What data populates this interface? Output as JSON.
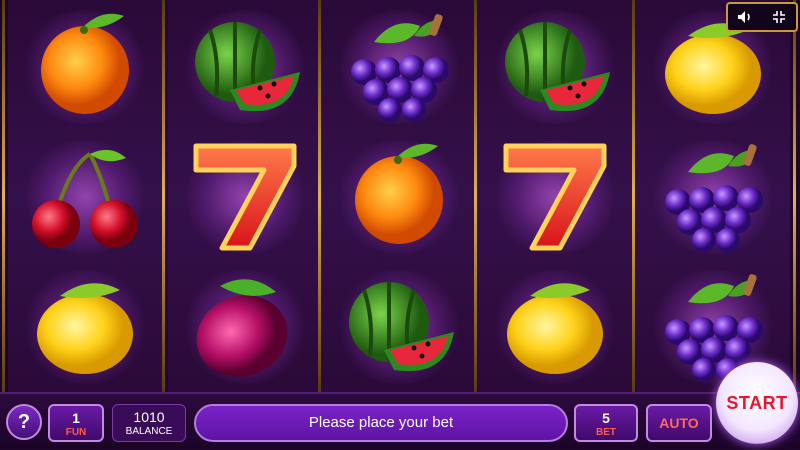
{
  "window": {
    "title": ""
  },
  "top_controls": {
    "icons": [
      "speaker-icon",
      "minimize-icon"
    ]
  },
  "reels": [
    [
      "orange",
      "cherries",
      "lemon"
    ],
    [
      "watermelon",
      "seven",
      "plum"
    ],
    [
      "grapes",
      "orange",
      "watermelon"
    ],
    [
      "watermelon",
      "seven",
      "lemon"
    ],
    [
      "lemon",
      "grapes",
      "grapes"
    ]
  ],
  "bottom_bar": {
    "help_label": "?",
    "fun": {
      "value": "1",
      "label": "FUN"
    },
    "balance": {
      "value": "1010",
      "label": "BALANCE"
    },
    "message": "Please place your bet",
    "bet": {
      "value": "5",
      "label": "BET"
    },
    "auto_label": "AUTO",
    "start_label": "START"
  },
  "colors": {
    "accent": "#7a22c8",
    "frame_gold": "#e0b24a",
    "start_red": "#e8172c"
  }
}
